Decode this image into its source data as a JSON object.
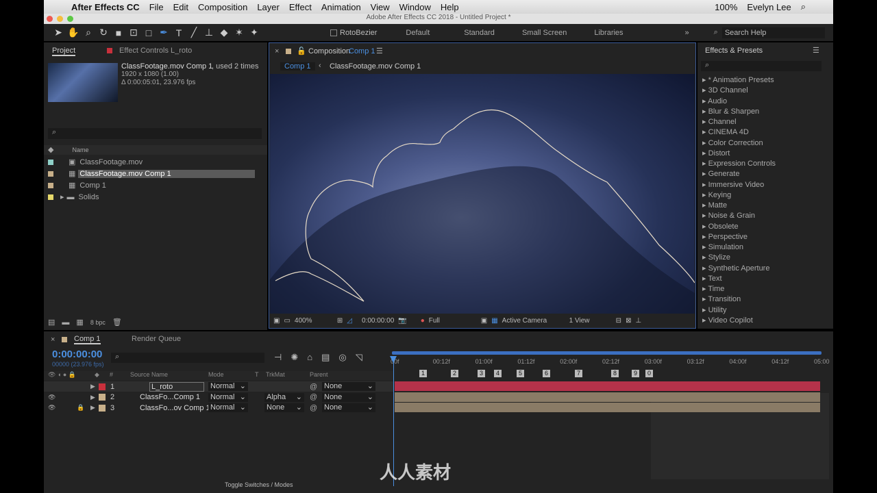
{
  "menubar": {
    "app": "After Effects CC",
    "items": [
      "File",
      "Edit",
      "Composition",
      "Layer",
      "Effect",
      "Animation",
      "View",
      "Window",
      "Help"
    ],
    "status": {
      "battery": "100%",
      "user": "Evelyn Lee"
    }
  },
  "window_title": "Adobe After Effects CC 2018 - Untitled Project *",
  "toolbar": {
    "rotobezier": "RotoBezier",
    "workspaces": [
      "Default",
      "Standard",
      "Small Screen",
      "Libraries"
    ],
    "search_help": "Search Help"
  },
  "project": {
    "tab": "Project",
    "effect_controls": "Effect Controls L_roto",
    "selected_name": "ClassFootage.mov Comp 1",
    "used": ", used 2 times",
    "resolution": "1920 x 1080 (1.00)",
    "duration": "Δ 0:00:05:01, 23.976 fps",
    "name_header": "Name",
    "items": [
      {
        "name": "ClassFootage.mov",
        "color": "#8fd0c8"
      },
      {
        "name": "ClassFootage.mov Comp 1",
        "color": "#c8b08a"
      },
      {
        "name": "Comp 1",
        "color": "#c8b08a"
      },
      {
        "name": "Solids",
        "color": "#e6d86a"
      }
    ],
    "bpc": "8 bpc"
  },
  "composition": {
    "tab_prefix": "Composition",
    "tab_name": "Comp 1",
    "breadcrumb": [
      "Comp 1",
      "ClassFootage.mov Comp 1"
    ],
    "zoom": "400%",
    "timecode": "0:00:00:00",
    "resolution": "Full",
    "camera": "Active Camera",
    "views": "1 View"
  },
  "effects": {
    "title": "Effects & Presets",
    "items": [
      "* Animation Presets",
      "3D Channel",
      "Audio",
      "Blur & Sharpen",
      "Channel",
      "CINEMA 4D",
      "Color Correction",
      "Distort",
      "Expression Controls",
      "Generate",
      "Immersive Video",
      "Keying",
      "Matte",
      "Noise & Grain",
      "Obsolete",
      "Perspective",
      "Simulation",
      "Stylize",
      "Synthetic Aperture",
      "Text",
      "Time",
      "Transition",
      "Utility",
      "Video Copilot"
    ]
  },
  "timeline": {
    "tab": "Comp 1",
    "render_queue": "Render Queue",
    "timecode": "0:00:00:00",
    "frames": "00000 (23.976 fps)",
    "headers": {
      "num": "#",
      "source": "Source Name",
      "mode": "Mode",
      "t": "T",
      "trkmat": "TrkMat",
      "parent": "Parent"
    },
    "layers": [
      {
        "num": "1",
        "name": "L_roto",
        "mode": "Normal",
        "trkmat": "",
        "parent": "None",
        "color": "#c8303c"
      },
      {
        "num": "2",
        "name": "ClassFo...Comp 1",
        "mode": "Normal",
        "trkmat": "Alpha",
        "parent": "None",
        "color": "#c8b08a"
      },
      {
        "num": "3",
        "name": "ClassFo...ov Comp 1",
        "mode": "Normal",
        "trkmat": "None",
        "parent": "None",
        "color": "#c8b08a"
      }
    ],
    "ruler": [
      "00f",
      "00:12f",
      "01:00f",
      "01:12f",
      "02:00f",
      "02:12f",
      "03:00f",
      "03:12f",
      "04:00f",
      "04:12f",
      "05:00"
    ],
    "markers": [
      "1",
      "2",
      "3",
      "4",
      "5",
      "6",
      "7",
      "8",
      "9",
      "0"
    ],
    "toggle": "Toggle Switches / Modes"
  },
  "watermark": "人人素材"
}
